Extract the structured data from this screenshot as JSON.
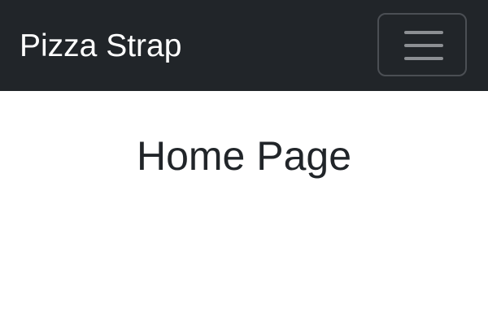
{
  "navbar": {
    "brand": "Pizza Strap",
    "toggler_icon": "hamburger-menu-icon",
    "background_color": "#212529",
    "brand_color": "#ffffff"
  },
  "main": {
    "title": "Home Page",
    "title_color": "#212529",
    "background_color": "#ffffff"
  }
}
